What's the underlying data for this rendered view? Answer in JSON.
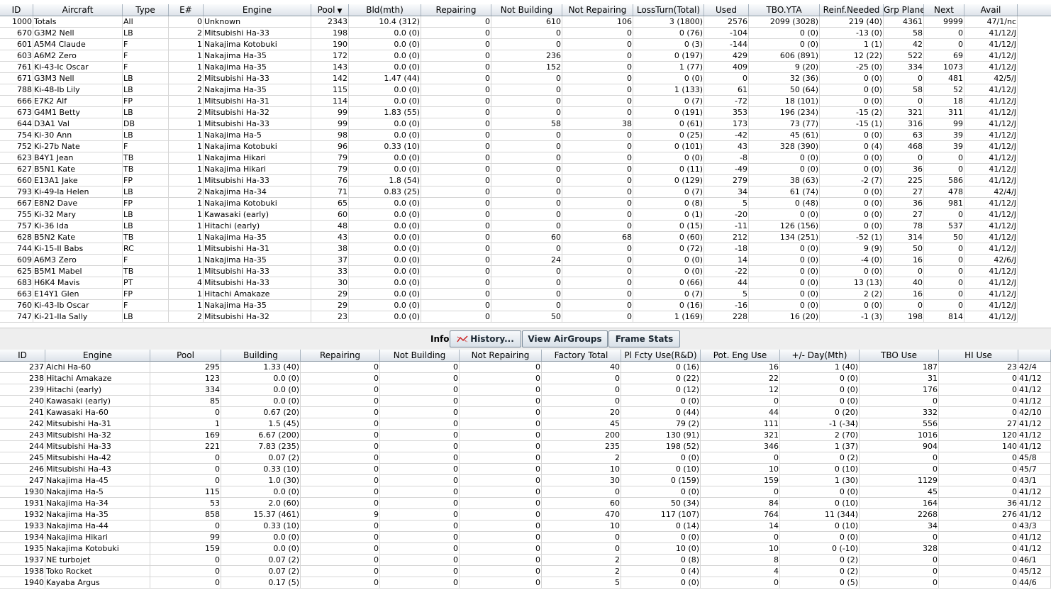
{
  "top_table": {
    "columns": [
      "ID",
      "Aircraft",
      "Type",
      "E#",
      "Engine",
      "Pool",
      "Bld(mth)",
      "Repairing",
      "Not Building",
      "Not Repairing",
      "LossTurn(Total)",
      "Used",
      "TBO.YTA",
      "Reinf.Needed",
      "Grp Planes",
      "Next",
      "Avail"
    ],
    "sort_column": "Pool",
    "rows": [
      [
        "1000",
        "Totals",
        "All",
        "0",
        "Unknown",
        "2343",
        "10.4 (312)",
        "0",
        "610",
        "106",
        "3 (1800)",
        "2576",
        "2099 (3028)",
        "219 (40)",
        "4361",
        "9999",
        "47/1/nc"
      ],
      [
        "670",
        "G3M2 Nell",
        "LB",
        "2",
        "Mitsubishi Ha-33",
        "198",
        "0.0 (0)",
        "0",
        "0",
        "0",
        "0 (76)",
        "-104",
        "0 (0)",
        "-13 (0)",
        "58",
        "0",
        "41/12/J"
      ],
      [
        "601",
        "A5M4 Claude",
        "F",
        "1",
        "Nakajima Kotobuki",
        "190",
        "0.0 (0)",
        "0",
        "0",
        "0",
        "0 (3)",
        "-144",
        "0 (0)",
        "1 (1)",
        "42",
        "0",
        "41/12/J"
      ],
      [
        "603",
        "A6M2 Zero",
        "F",
        "1",
        "Nakajima Ha-35",
        "172",
        "0.0 (0)",
        "0",
        "236",
        "0",
        "0 (197)",
        "429",
        "606 (891)",
        "12 (22)",
        "522",
        "69",
        "41/12/J"
      ],
      [
        "761",
        "Ki-43-Ic Oscar",
        "F",
        "1",
        "Nakajima Ha-35",
        "143",
        "0.0 (0)",
        "0",
        "152",
        "0",
        "1 (77)",
        "409",
        "9 (20)",
        "-25 (0)",
        "334",
        "1073",
        "41/12/J"
      ],
      [
        "671",
        "G3M3 Nell",
        "LB",
        "2",
        "Mitsubishi Ha-33",
        "142",
        "1.47 (44)",
        "0",
        "0",
        "0",
        "0 (0)",
        "0",
        "32 (36)",
        "0 (0)",
        "0",
        "481",
        "42/5/J"
      ],
      [
        "788",
        "Ki-48-Ib Lily",
        "LB",
        "2",
        "Nakajima Ha-35",
        "115",
        "0.0 (0)",
        "0",
        "0",
        "0",
        "1 (133)",
        "61",
        "50 (64)",
        "0 (0)",
        "58",
        "52",
        "41/12/J"
      ],
      [
        "666",
        "E7K2 Alf",
        "FP",
        "1",
        "Mitsubishi Ha-31",
        "114",
        "0.0 (0)",
        "0",
        "0",
        "0",
        "0 (7)",
        "-72",
        "18 (101)",
        "0 (0)",
        "0",
        "18",
        "41/12/J"
      ],
      [
        "673",
        "G4M1 Betty",
        "LB",
        "2",
        "Mitsubishi Ha-32",
        "99",
        "1.83 (55)",
        "0",
        "0",
        "0",
        "0 (191)",
        "353",
        "196 (234)",
        "-15 (2)",
        "321",
        "311",
        "41/12/J"
      ],
      [
        "644",
        "D3A1 Val",
        "DB",
        "1",
        "Mitsubishi Ha-33",
        "99",
        "0.0 (0)",
        "0",
        "58",
        "38",
        "0 (61)",
        "173",
        "73 (77)",
        "-15 (1)",
        "316",
        "99",
        "41/12/J"
      ],
      [
        "754",
        "Ki-30 Ann",
        "LB",
        "1",
        "Nakajima Ha-5",
        "98",
        "0.0 (0)",
        "0",
        "0",
        "0",
        "0 (25)",
        "-42",
        "45 (61)",
        "0 (0)",
        "63",
        "39",
        "41/12/J"
      ],
      [
        "752",
        "Ki-27b Nate",
        "F",
        "1",
        "Nakajima Kotobuki",
        "96",
        "0.33 (10)",
        "0",
        "0",
        "0",
        "0 (101)",
        "43",
        "328 (390)",
        "0 (4)",
        "468",
        "39",
        "41/12/J"
      ],
      [
        "623",
        "B4Y1 Jean",
        "TB",
        "1",
        "Nakajima Hikari",
        "79",
        "0.0 (0)",
        "0",
        "0",
        "0",
        "0 (0)",
        "-8",
        "0 (0)",
        "0 (0)",
        "0",
        "0",
        "41/12/J"
      ],
      [
        "627",
        "B5N1 Kate",
        "TB",
        "1",
        "Nakajima Hikari",
        "79",
        "0.0 (0)",
        "0",
        "0",
        "0",
        "0 (11)",
        "-49",
        "0 (0)",
        "0 (0)",
        "36",
        "0",
        "41/12/J"
      ],
      [
        "660",
        "E13A1 Jake",
        "FP",
        "1",
        "Mitsubishi Ha-33",
        "76",
        "1.8 (54)",
        "0",
        "0",
        "0",
        "0 (129)",
        "279",
        "38 (63)",
        "-2 (7)",
        "225",
        "586",
        "41/12/J"
      ],
      [
        "793",
        "Ki-49-Ia Helen",
        "LB",
        "2",
        "Nakajima Ha-34",
        "71",
        "0.83 (25)",
        "0",
        "0",
        "0",
        "0 (7)",
        "34",
        "61 (74)",
        "0 (0)",
        "27",
        "478",
        "42/4/J"
      ],
      [
        "667",
        "E8N2 Dave",
        "FP",
        "1",
        "Nakajima Kotobuki",
        "65",
        "0.0 (0)",
        "0",
        "0",
        "0",
        "0 (8)",
        "5",
        "0 (48)",
        "0 (0)",
        "36",
        "981",
        "41/12/J"
      ],
      [
        "755",
        "Ki-32 Mary",
        "LB",
        "1",
        "Kawasaki (early)",
        "60",
        "0.0 (0)",
        "0",
        "0",
        "0",
        "0 (1)",
        "-20",
        "0 (0)",
        "0 (0)",
        "27",
        "0",
        "41/12/J"
      ],
      [
        "757",
        "Ki-36 Ida",
        "LB",
        "1",
        "Hitachi (early)",
        "48",
        "0.0 (0)",
        "0",
        "0",
        "0",
        "0 (15)",
        "-11",
        "126 (156)",
        "0 (0)",
        "78",
        "537",
        "41/12/J"
      ],
      [
        "628",
        "B5N2 Kate",
        "TB",
        "1",
        "Nakajima Ha-35",
        "43",
        "0.0 (0)",
        "0",
        "60",
        "68",
        "0 (60)",
        "212",
        "134 (251)",
        "-52 (1)",
        "314",
        "50",
        "41/12/J"
      ],
      [
        "744",
        "Ki-15-II Babs",
        "RC",
        "1",
        "Mitsubishi Ha-31",
        "38",
        "0.0 (0)",
        "0",
        "0",
        "0",
        "0 (72)",
        "-18",
        "0 (0)",
        "9 (9)",
        "50",
        "0",
        "41/12/J"
      ],
      [
        "609",
        "A6M3 Zero",
        "F",
        "1",
        "Nakajima Ha-35",
        "37",
        "0.0 (0)",
        "0",
        "24",
        "0",
        "0 (0)",
        "14",
        "0 (0)",
        "-4 (0)",
        "16",
        "0",
        "42/6/J"
      ],
      [
        "625",
        "B5M1 Mabel",
        "TB",
        "1",
        "Mitsubishi Ha-33",
        "33",
        "0.0 (0)",
        "0",
        "0",
        "0",
        "0 (0)",
        "-22",
        "0 (0)",
        "0 (0)",
        "0",
        "0",
        "41/12/J"
      ],
      [
        "683",
        "H6K4 Mavis",
        "PT",
        "4",
        "Mitsubishi Ha-33",
        "30",
        "0.0 (0)",
        "0",
        "0",
        "0",
        "0 (66)",
        "44",
        "0 (0)",
        "13 (13)",
        "40",
        "0",
        "41/12/J"
      ],
      [
        "663",
        "E14Y1 Glen",
        "FP",
        "1",
        "Hitachi Amakaze",
        "29",
        "0.0 (0)",
        "0",
        "0",
        "0",
        "0 (7)",
        "5",
        "0 (0)",
        "2 (2)",
        "16",
        "0",
        "41/12/J"
      ],
      [
        "760",
        "Ki-43-Ib Oscar",
        "F",
        "1",
        "Nakajima Ha-35",
        "29",
        "0.0 (0)",
        "0",
        "0",
        "0",
        "0 (16)",
        "-16",
        "0 (0)",
        "0 (0)",
        "0",
        "0",
        "41/12/J"
      ],
      [
        "747",
        "Ki-21-IIa Sally",
        "LB",
        "2",
        "Mitsubishi Ha-32",
        "23",
        "0.0 (0)",
        "0",
        "50",
        "0",
        "1 (169)",
        "228",
        "16 (20)",
        "-1 (3)",
        "198",
        "814",
        "41/12/J"
      ]
    ]
  },
  "info_bar": {
    "label": "Info:",
    "history_button": "History...",
    "history_icon": "line-chart-icon",
    "airgroups_button": "View AirGroups",
    "framestats_button": "Frame Stats",
    "icon_color": "#cc2222"
  },
  "bottom_table": {
    "columns": [
      "ID",
      "Engine",
      "Pool",
      "Building",
      "Repairing",
      "Not Building",
      "Not Repairing",
      "Factory Total",
      "Pl Fcty Use(R&D)",
      "Pot. Eng Use",
      "+/- Day(Mth)",
      "TBO Use",
      "HI Use",
      ""
    ],
    "rows": [
      [
        "237",
        "Aichi Ha-60",
        "295",
        "1.33 (40)",
        "0",
        "0",
        "0",
        "40",
        "0 (16)",
        "16",
        "1 (40)",
        "187",
        "23",
        "42/4"
      ],
      [
        "238",
        "Hitachi Amakaze",
        "123",
        "0.0 (0)",
        "0",
        "0",
        "0",
        "0",
        "0 (22)",
        "22",
        "0 (0)",
        "31",
        "0",
        "41/12"
      ],
      [
        "239",
        "Hitachi (early)",
        "334",
        "0.0 (0)",
        "0",
        "0",
        "0",
        "0",
        "0 (12)",
        "12",
        "0 (0)",
        "176",
        "0",
        "41/12"
      ],
      [
        "240",
        "Kawasaki (early)",
        "85",
        "0.0 (0)",
        "0",
        "0",
        "0",
        "0",
        "0 (0)",
        "0",
        "0 (0)",
        "0",
        "0",
        "41/12"
      ],
      [
        "241",
        "Kawasaki Ha-60",
        "0",
        "0.67 (20)",
        "0",
        "0",
        "0",
        "20",
        "0 (44)",
        "44",
        "0 (20)",
        "332",
        "0",
        "42/10"
      ],
      [
        "242",
        "Mitsubishi Ha-31",
        "1",
        "1.5 (45)",
        "0",
        "0",
        "0",
        "45",
        "79 (2)",
        "111",
        "-1 (-34)",
        "556",
        "27",
        "41/12"
      ],
      [
        "243",
        "Mitsubishi Ha-32",
        "169",
        "6.67 (200)",
        "0",
        "0",
        "0",
        "200",
        "130 (91)",
        "321",
        "2 (70)",
        "1016",
        "120",
        "41/12"
      ],
      [
        "244",
        "Mitsubishi Ha-33",
        "221",
        "7.83 (235)",
        "0",
        "0",
        "0",
        "235",
        "198 (52)",
        "346",
        "1 (37)",
        "904",
        "140",
        "41/12"
      ],
      [
        "245",
        "Mitsubishi Ha-42",
        "0",
        "0.07 (2)",
        "0",
        "0",
        "0",
        "2",
        "0 (0)",
        "0",
        "0 (2)",
        "0",
        "0",
        "45/8"
      ],
      [
        "246",
        "Mitsubishi Ha-43",
        "0",
        "0.33 (10)",
        "0",
        "0",
        "0",
        "10",
        "0 (10)",
        "10",
        "0 (10)",
        "0",
        "0",
        "45/7"
      ],
      [
        "247",
        "Nakajima Ha-45",
        "0",
        "1.0 (30)",
        "0",
        "0",
        "0",
        "30",
        "0 (159)",
        "159",
        "1 (30)",
        "1129",
        "0",
        "43/1"
      ],
      [
        "1930",
        "Nakajima Ha-5",
        "115",
        "0.0 (0)",
        "0",
        "0",
        "0",
        "0",
        "0 (0)",
        "0",
        "0 (0)",
        "45",
        "0",
        "41/12"
      ],
      [
        "1931",
        "Nakajima Ha-34",
        "53",
        "2.0 (60)",
        "0",
        "0",
        "0",
        "60",
        "50 (34)",
        "84",
        "0 (10)",
        "164",
        "36",
        "41/12"
      ],
      [
        "1932",
        "Nakajima Ha-35",
        "858",
        "15.37 (461)",
        "9",
        "0",
        "0",
        "470",
        "117 (107)",
        "764",
        "11 (344)",
        "2268",
        "276",
        "41/12"
      ],
      [
        "1933",
        "Nakajima Ha-44",
        "0",
        "0.33 (10)",
        "0",
        "0",
        "0",
        "10",
        "0 (14)",
        "14",
        "0 (10)",
        "34",
        "0",
        "43/3"
      ],
      [
        "1934",
        "Nakajima Hikari",
        "99",
        "0.0 (0)",
        "0",
        "0",
        "0",
        "0",
        "0 (0)",
        "0",
        "0 (0)",
        "0",
        "0",
        "41/12"
      ],
      [
        "1935",
        "Nakajima Kotobuki",
        "159",
        "0.0 (0)",
        "0",
        "0",
        "0",
        "0",
        "10 (0)",
        "10",
        "0 (-10)",
        "328",
        "0",
        "41/12"
      ],
      [
        "1937",
        "NE turbojet",
        "0",
        "0.07 (2)",
        "0",
        "0",
        "0",
        "2",
        "0 (8)",
        "8",
        "0 (2)",
        "0",
        "0",
        "46/1"
      ],
      [
        "1938",
        "Toko Rocket",
        "0",
        "0.07 (2)",
        "0",
        "0",
        "0",
        "2",
        "0 (4)",
        "4",
        "0 (2)",
        "0",
        "0",
        "45/12"
      ],
      [
        "1940",
        "Kayaba Argus",
        "0",
        "0.17 (5)",
        "0",
        "0",
        "0",
        "5",
        "0 (0)",
        "0",
        "0 (5)",
        "0",
        "0",
        "44/6"
      ]
    ]
  }
}
